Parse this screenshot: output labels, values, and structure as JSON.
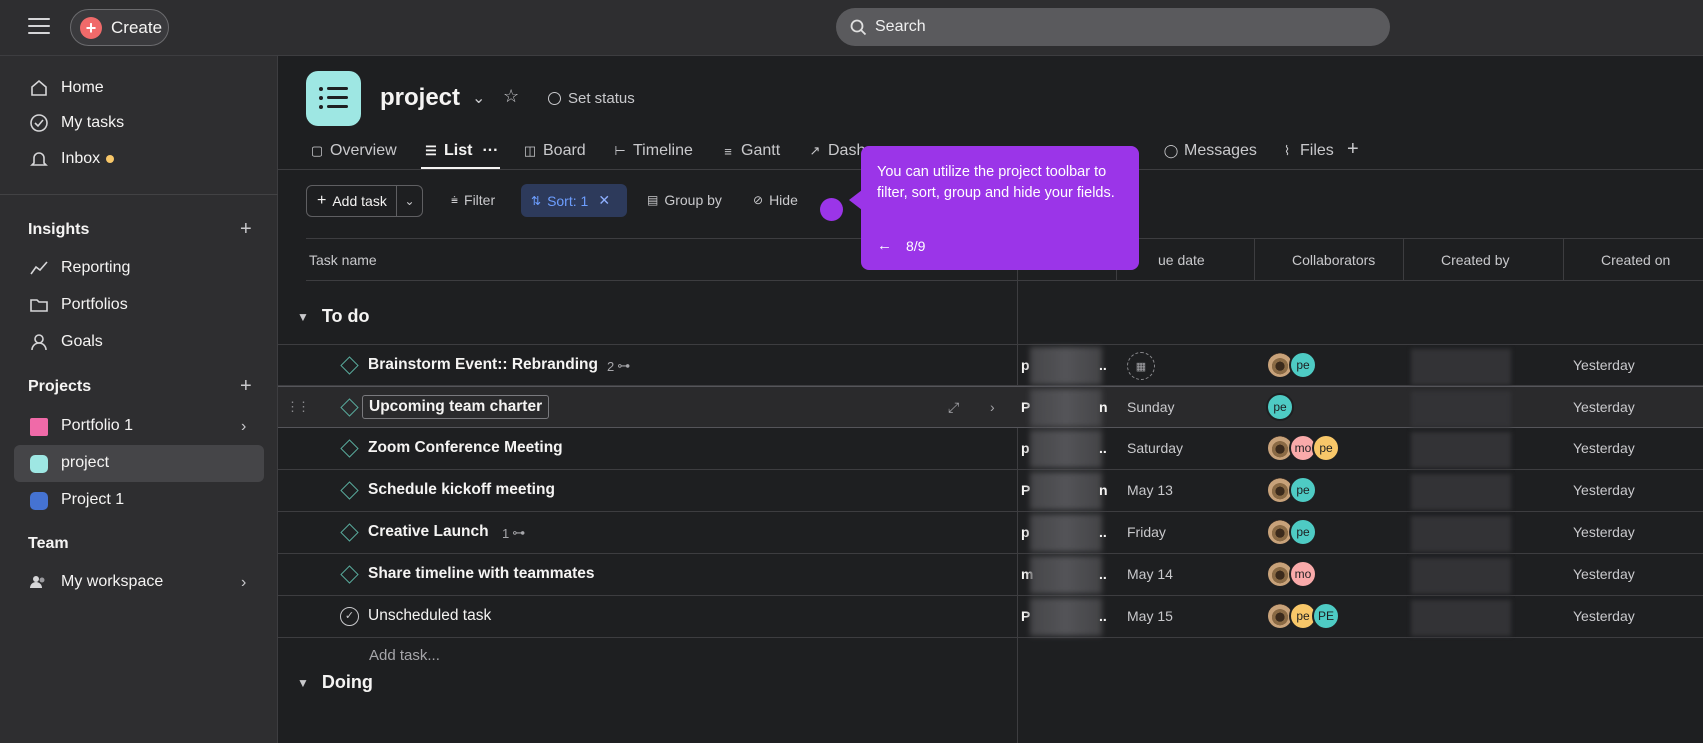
{
  "topbar": {
    "create_label": "Create",
    "search_placeholder": "Search"
  },
  "sidebar": {
    "nav": [
      {
        "label": "Home",
        "icon": "home-icon"
      },
      {
        "label": "My tasks",
        "icon": "check-circle-icon"
      },
      {
        "label": "Inbox",
        "icon": "bell-icon"
      }
    ],
    "insights": {
      "title": "Insights",
      "items": [
        {
          "label": "Reporting",
          "icon": "chart-line-icon"
        },
        {
          "label": "Portfolios",
          "icon": "folder-icon"
        },
        {
          "label": "Goals",
          "icon": "person-goal-icon"
        }
      ]
    },
    "projects": {
      "title": "Projects",
      "items": [
        {
          "label": "Portfolio 1",
          "color": "#f06aa8"
        },
        {
          "label": "project",
          "color": "#9ee7e3"
        },
        {
          "label": "Project 1",
          "color": "#4573d2"
        }
      ]
    },
    "team": {
      "title": "Team",
      "items": [
        {
          "label": "My workspace",
          "icon": "people-icon"
        }
      ]
    }
  },
  "project": {
    "title": "project",
    "set_status": "Set status",
    "tabs": [
      {
        "label": "Overview"
      },
      {
        "label": "List"
      },
      {
        "label": "Board"
      },
      {
        "label": "Timeline"
      },
      {
        "label": "Gantt"
      },
      {
        "label": "Dash"
      },
      {
        "label": "Messages"
      },
      {
        "label": "Files"
      }
    ]
  },
  "toolbar": {
    "add_task": "Add task",
    "filter": "Filter",
    "sort": "Sort: 1",
    "group_by": "Group by",
    "hide": "Hide"
  },
  "tooltip": {
    "message": "You can utilize the project toolbar to filter, sort, group and hide your fields.",
    "step": "8/9"
  },
  "grid": {
    "columns": [
      "Task name",
      "ue date",
      "Collaborators",
      "Created by",
      "Created on"
    ],
    "groups": [
      {
        "title": "To do",
        "rows": [
          {
            "name": "Brainstorm Event:: Rebranding",
            "subtasks": "2",
            "assignee_start": "p",
            "assignee_end": "..",
            "due": "",
            "collaborators": [
              "photo",
              "pe"
            ],
            "created_on": "Yesterday"
          },
          {
            "name": "Upcoming team charter",
            "subtasks": "",
            "assignee_start": "P",
            "assignee_end": "n",
            "due": "Sunday",
            "collaborators": [
              "pe"
            ],
            "created_on": "Yesterday"
          },
          {
            "name": "Zoom Conference Meeting",
            "subtasks": "",
            "assignee_start": "p",
            "assignee_end": "..",
            "due": "Saturday",
            "collaborators": [
              "photo",
              "mo",
              "pe"
            ],
            "created_on": "Yesterday"
          },
          {
            "name": "Schedule kickoff meeting",
            "subtasks": "",
            "assignee_start": "P",
            "assignee_end": "n",
            "due": "May 13",
            "collaborators": [
              "photo",
              "pe"
            ],
            "created_on": "Yesterday"
          },
          {
            "name": "Creative Launch",
            "subtasks": "1",
            "assignee_start": "p",
            "assignee_end": "..",
            "due": "Friday",
            "collaborators": [
              "photo",
              "pe"
            ],
            "created_on": "Yesterday"
          },
          {
            "name": "Share timeline with teammates",
            "subtasks": "",
            "assignee_start": "m",
            "assignee_end": "..",
            "due": "May 14",
            "collaborators": [
              "photo",
              "mo"
            ],
            "created_on": "Yesterday"
          },
          {
            "name": "Unscheduled task",
            "subtasks": "",
            "assignee_start": "P",
            "assignee_end": "..",
            "due": "May 15",
            "collaborators": [
              "photo",
              "pe",
              "PE"
            ],
            "created_on": "Yesterday"
          }
        ],
        "add_task": "Add task..."
      },
      {
        "title": "Doing",
        "rows": []
      }
    ]
  },
  "colors": {
    "accent_purple": "#9b35e8",
    "sort_blue": "#6d9eff",
    "create_red": "#f06a6a",
    "avatar_pe": "#4ecbc4",
    "avatar_mo": "#f9aaaa",
    "avatar_pe_orange": "#f8c769"
  }
}
